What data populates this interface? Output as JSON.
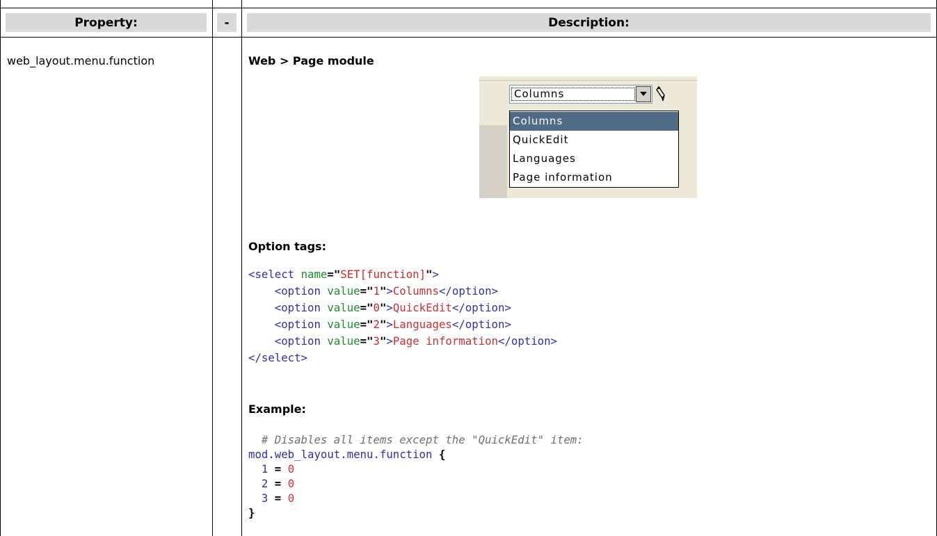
{
  "table": {
    "headers": {
      "property": "Property:",
      "dash": "-",
      "description": "Description:"
    },
    "row": {
      "property": "web_layout.menu.function",
      "description_title": "Web > Page module"
    }
  },
  "screenshot": {
    "select_value": "Columns",
    "options": [
      "Columns",
      "QuickEdit",
      "Languages",
      "Page information"
    ],
    "selected_index": 0,
    "icons": [
      "dropdown-arrow-icon",
      "pencil-icon"
    ]
  },
  "sections": {
    "option_tags_label": "Option tags:",
    "example_label": "Example:"
  },
  "code_option_tags": {
    "select_open_tag": "<select",
    "select_attr": "name",
    "select_value": "SET[function]",
    "select_close": ">",
    "options": [
      {
        "value": "1",
        "label": "Columns"
      },
      {
        "value": "0",
        "label": "QuickEdit"
      },
      {
        "value": "2",
        "label": "Languages"
      },
      {
        "value": "3",
        "label": "Page information"
      }
    ],
    "option_open": "<option",
    "option_attr": "value",
    "option_end": "</option>",
    "select_end": "</select>"
  },
  "code_example": {
    "comment": "# Disables all items except the \"QuickEdit\" item:",
    "object_path": "mod.web_layout.menu.function",
    "open_brace": "{",
    "assignments": [
      {
        "key": "1",
        "op": "=",
        "val": "0"
      },
      {
        "key": "2",
        "op": "=",
        "val": "0"
      },
      {
        "key": "3",
        "op": "=",
        "val": "0"
      }
    ],
    "close_brace": "}"
  }
}
